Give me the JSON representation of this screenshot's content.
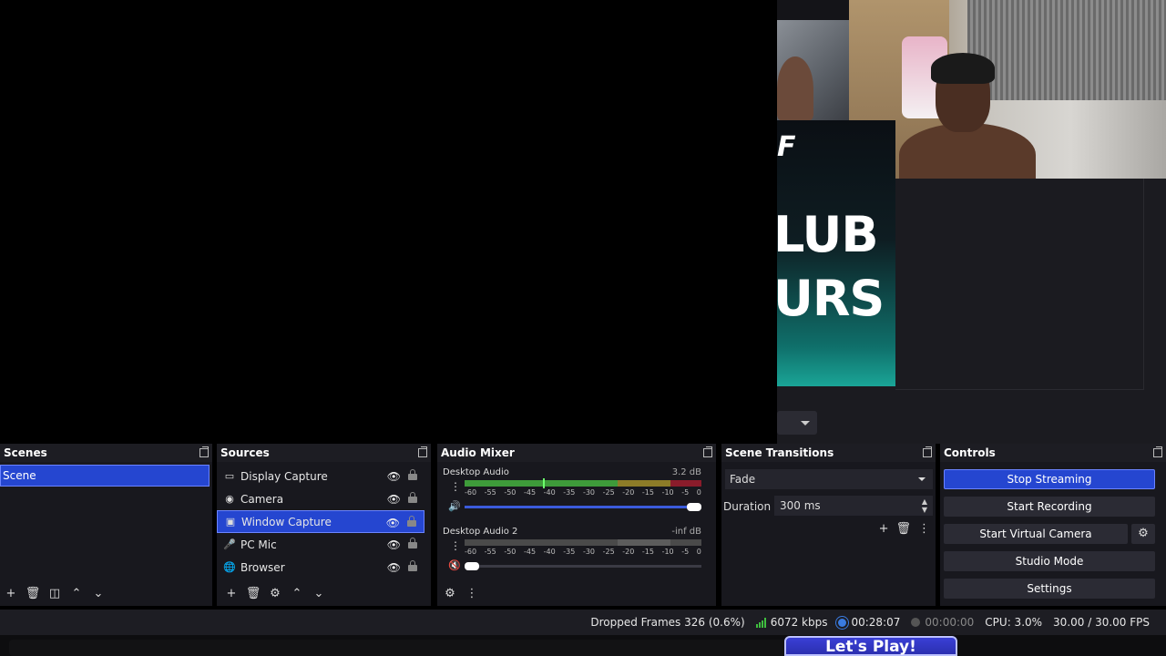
{
  "preview": {
    "brand_top": "F",
    "brand_line1": "LUB",
    "brand_line2": "URS"
  },
  "docks": {
    "scenes": {
      "title": "Scenes",
      "items": [
        "Scene"
      ]
    },
    "sources": {
      "title": "Sources",
      "items": [
        {
          "label": "Display Capture",
          "icon": "monitor-icon"
        },
        {
          "label": "Camera",
          "icon": "camera-icon"
        },
        {
          "label": "Window Capture",
          "icon": "window-icon",
          "selected": true
        },
        {
          "label": "PC Mic",
          "icon": "microphone-icon"
        },
        {
          "label": "Browser",
          "icon": "globe-icon"
        }
      ]
    },
    "mixer": {
      "title": "Audio Mixer",
      "channels": [
        {
          "name": "Desktop Audio",
          "db": "3.2 dB",
          "volume_fraction": 0.98
        },
        {
          "name": "Desktop Audio 2",
          "db": "-inf dB",
          "volume_fraction": 0.0,
          "muted": true
        }
      ],
      "ticks": [
        "-60",
        "-55",
        "-50",
        "-45",
        "-40",
        "-35",
        "-30",
        "-25",
        "-20",
        "-15",
        "-10",
        "-5",
        "0"
      ]
    },
    "transitions": {
      "title": "Scene Transitions",
      "selected": "Fade",
      "duration_label": "Duration",
      "duration_value": "300 ms"
    },
    "controls": {
      "title": "Controls",
      "stop_streaming": "Stop Streaming",
      "start_recording": "Start Recording",
      "start_virtual_camera": "Start Virtual Camera",
      "studio_mode": "Studio Mode",
      "settings": "Settings"
    }
  },
  "status": {
    "dropped_frames": "Dropped Frames 326 (0.6%)",
    "bitrate": "6072 kbps",
    "stream_time": "00:28:07",
    "record_time": "00:00:00",
    "cpu": "CPU: 3.0%",
    "fps": "30.00 / 30.00 FPS"
  },
  "overlay": {
    "lets_play": "Let's Play!"
  },
  "colors": {
    "accent": "#2546d0",
    "dock_bg": "#1d1d23",
    "meter_green": "#3e9b3a",
    "meter_yellow": "#8d7c28",
    "meter_red": "#8a1c2b"
  }
}
